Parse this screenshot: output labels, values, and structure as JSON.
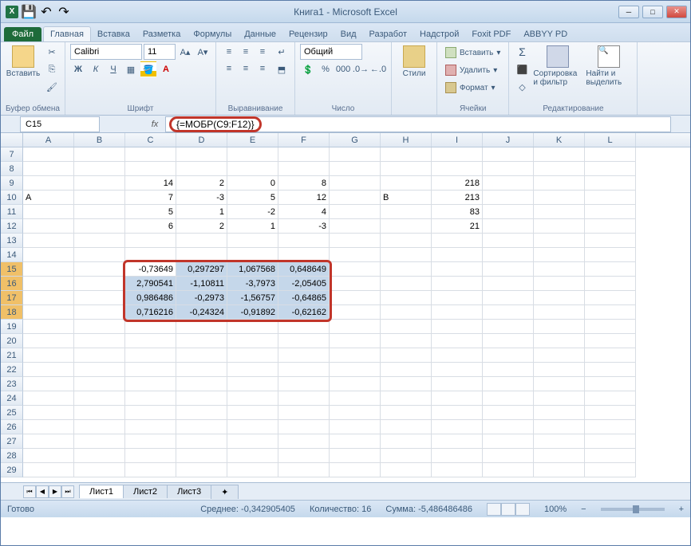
{
  "title": "Книга1 - Microsoft Excel",
  "tabs": {
    "file": "Файл",
    "home": "Главная",
    "insert": "Вставка",
    "layout": "Разметка",
    "formulas": "Формулы",
    "data": "Данные",
    "review": "Рецензир",
    "view": "Вид",
    "dev": "Разработ",
    "addin": "Надстрой",
    "foxit": "Foxit PDF",
    "abbyy": "ABBYY PD"
  },
  "groups": {
    "clipboard": "Буфер обмена",
    "font": "Шрифт",
    "align": "Выравнивание",
    "number": "Число",
    "styles": "Стили",
    "cells": "Ячейки",
    "editing": "Редактирование"
  },
  "ribbon": {
    "paste": "Вставить",
    "font_name": "Calibri",
    "font_size": "11",
    "num_format": "Общий",
    "styles": "Стили",
    "insert": "Вставить",
    "delete": "Удалить",
    "format": "Формат",
    "sort": "Сортировка и фильтр",
    "find": "Найти и выделить"
  },
  "namebox": "C15",
  "formula": "{=МОБР(C9:F12)}",
  "cols": [
    "A",
    "B",
    "C",
    "D",
    "E",
    "F",
    "G",
    "H",
    "I",
    "J",
    "K",
    "L"
  ],
  "row_nums": [
    "7",
    "8",
    "9",
    "10",
    "11",
    "12",
    "13",
    "14",
    "15",
    "16",
    "17",
    "18",
    "19",
    "20",
    "21",
    "22",
    "23",
    "24",
    "25",
    "26",
    "27",
    "28",
    "29"
  ],
  "grid": {
    "9": {
      "C": "14",
      "D": "2",
      "E": "0",
      "F": "8",
      "I": "218"
    },
    "10": {
      "A": "A",
      "C": "7",
      "D": "-3",
      "E": "5",
      "F": "12",
      "H": "B",
      "I": "213"
    },
    "11": {
      "C": "5",
      "D": "1",
      "E": "-2",
      "F": "4",
      "I": "83"
    },
    "12": {
      "C": "6",
      "D": "2",
      "E": "1",
      "F": "-3",
      "I": "21"
    },
    "15": {
      "C": "-0,73649",
      "D": "0,297297",
      "E": "1,067568",
      "F": "0,648649"
    },
    "16": {
      "C": "2,790541",
      "D": "-1,10811",
      "E": "-3,7973",
      "F": "-2,05405"
    },
    "17": {
      "C": "0,986486",
      "D": "-0,2973",
      "E": "-1,56757",
      "F": "-0,64865"
    },
    "18": {
      "C": "0,716216",
      "D": "-0,24324",
      "E": "-0,91892",
      "F": "-0,62162"
    }
  },
  "selection": {
    "rows": [
      "15",
      "16",
      "17",
      "18"
    ],
    "cols": [
      "C",
      "D",
      "E",
      "F"
    ],
    "active": "C15"
  },
  "sheets": {
    "s1": "Лист1",
    "s2": "Лист2",
    "s3": "Лист3"
  },
  "status": {
    "ready": "Готово",
    "avg_lbl": "Среднее:",
    "avg": "-0,342905405",
    "cnt_lbl": "Количество:",
    "cnt": "16",
    "sum_lbl": "Сумма:",
    "sum": "-5,486486486",
    "zoom": "100%"
  }
}
